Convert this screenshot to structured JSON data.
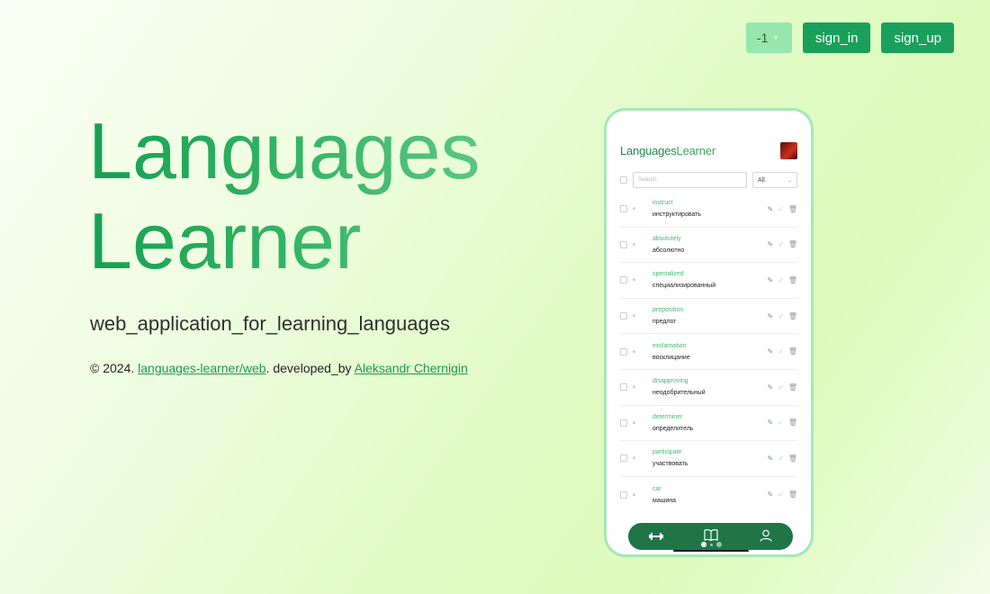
{
  "header": {
    "lang_select_value": "-1",
    "sign_in_label": "sign_in",
    "sign_up_label": "sign_up"
  },
  "hero": {
    "title_line1": "Languages",
    "title_line2": "Learner",
    "tagline": "web_application_for_learning_languages"
  },
  "footer": {
    "copyright": "© 2024. ",
    "repo_link": "languages-learner/web",
    "developed_by": ". developed_by ",
    "author_link": "Aleksandr Chernigin"
  },
  "phone": {
    "logo_part1": "Languages",
    "logo_part2": "Learner",
    "search_placeholder": "Search",
    "filter_value": "All",
    "words": [
      {
        "en": "instruct",
        "ru": "инструктировать"
      },
      {
        "en": "absolutely",
        "ru": "абсолютно"
      },
      {
        "en": "specialized",
        "ru": "специализированный"
      },
      {
        "en": "preposition",
        "ru": "предлог"
      },
      {
        "en": "exclamation",
        "ru": "восклицание"
      },
      {
        "en": "disapproving",
        "ru": "неодобрительный"
      },
      {
        "en": "determiner",
        "ru": "определитель"
      },
      {
        "en": "participate",
        "ru": "участвовать"
      },
      {
        "en": "car",
        "ru": "машина"
      }
    ]
  },
  "icons": {
    "chevron": "chevron-down-icon",
    "speaker": "speaker-icon",
    "edit": "pencil-icon",
    "check": "check-icon",
    "delete": "trash-icon",
    "nav_train": "dumbbell-icon",
    "nav_dictionary": "book-icon",
    "nav_profile": "user-icon"
  },
  "colors": {
    "accent": "#1aa05a",
    "nav_bg": "#207547",
    "lang_select_bg": "#97e6ad"
  }
}
